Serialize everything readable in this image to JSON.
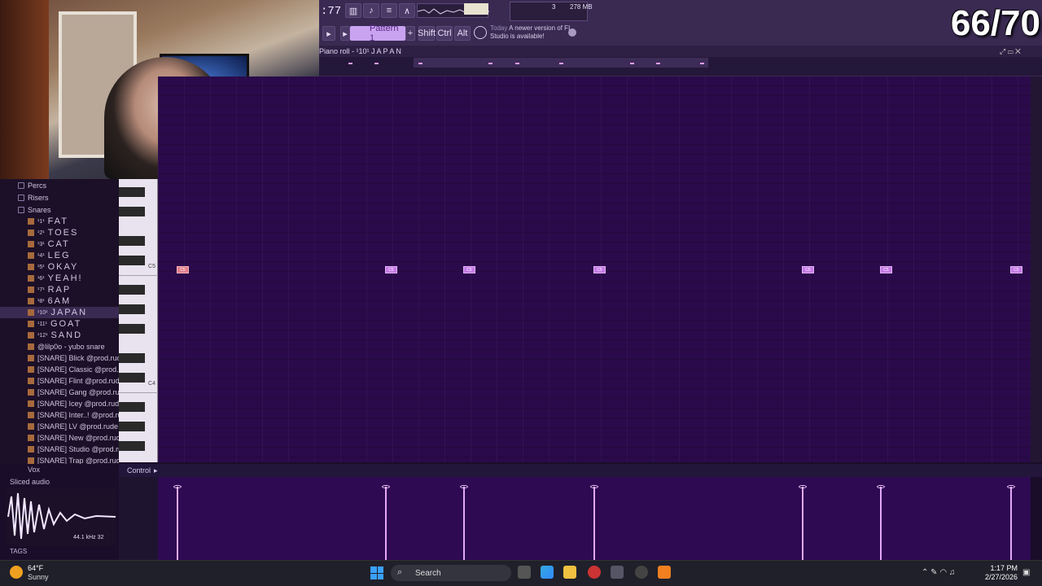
{
  "overlay": {
    "counter": "66/70"
  },
  "toolbar": {
    "time": ":77",
    "pattern": "Pattern 1",
    "mod_shift": "Shift",
    "mod_ctrl": "Ctrl",
    "mod_alt": "Alt",
    "mem": "278 MB",
    "cpu_num": "3",
    "news_title": "Today",
    "news_text": "A newer version of FL Studio is available!"
  },
  "piano_roll": {
    "title": "Piano roll - ¹10¹ J A P A N",
    "key_c5": "C5",
    "key_c4": "C4",
    "note_label": "C5",
    "notes_count": 7
  },
  "browser": {
    "folders_top": [
      "Percs",
      "Risers",
      "Snares"
    ],
    "snares": [
      {
        "num": "¹1¹",
        "name": "FAT"
      },
      {
        "num": "¹2¹",
        "name": "TOES"
      },
      {
        "num": "¹3¹",
        "name": "CAT"
      },
      {
        "num": "¹4¹",
        "name": "LEG"
      },
      {
        "num": "¹5¹",
        "name": "OKAY"
      },
      {
        "num": "¹6¹",
        "name": "YEAH!"
      },
      {
        "num": "¹7¹",
        "name": "RAP"
      },
      {
        "num": "¹8¹",
        "name": "6AM"
      },
      {
        "num": "¹10¹",
        "name": "JAPAN"
      },
      {
        "num": "¹11¹",
        "name": "GOAT"
      },
      {
        "num": "¹12¹",
        "name": "SAND"
      }
    ],
    "samples": [
      "@lilp0o - yubo snare",
      "[SNARE] Blick @prod.rude",
      "[SNARE] Classic @prod.rude",
      "[SNARE] Flint @prod.rude",
      "[SNARE] Gang @prod.rude",
      "[SNARE] Icey @prod.rude",
      "[SNARE] Inter..! @prod.rude",
      "[SNARE] LV @prod.rude",
      "[SNARE] New @prod.rude",
      "[SNARE] Studio @prod.rude",
      "[SNARE] Trap @prod.rude"
    ],
    "vox": "Vox",
    "sliced": "Sliced audio",
    "wave_info": "44.1 kHz 32",
    "tags": "TAGS"
  },
  "control": {
    "label": "Control"
  },
  "taskbar": {
    "temp": "64°F",
    "weather": "Sunny",
    "search": "Search",
    "time": "1:17 PM",
    "date": "2/27/2026"
  },
  "colors": {
    "grid": "#2a0a4a",
    "note": "#c57ae6",
    "note_selected": "#e27f8c",
    "accent": "#c9a3f0"
  }
}
